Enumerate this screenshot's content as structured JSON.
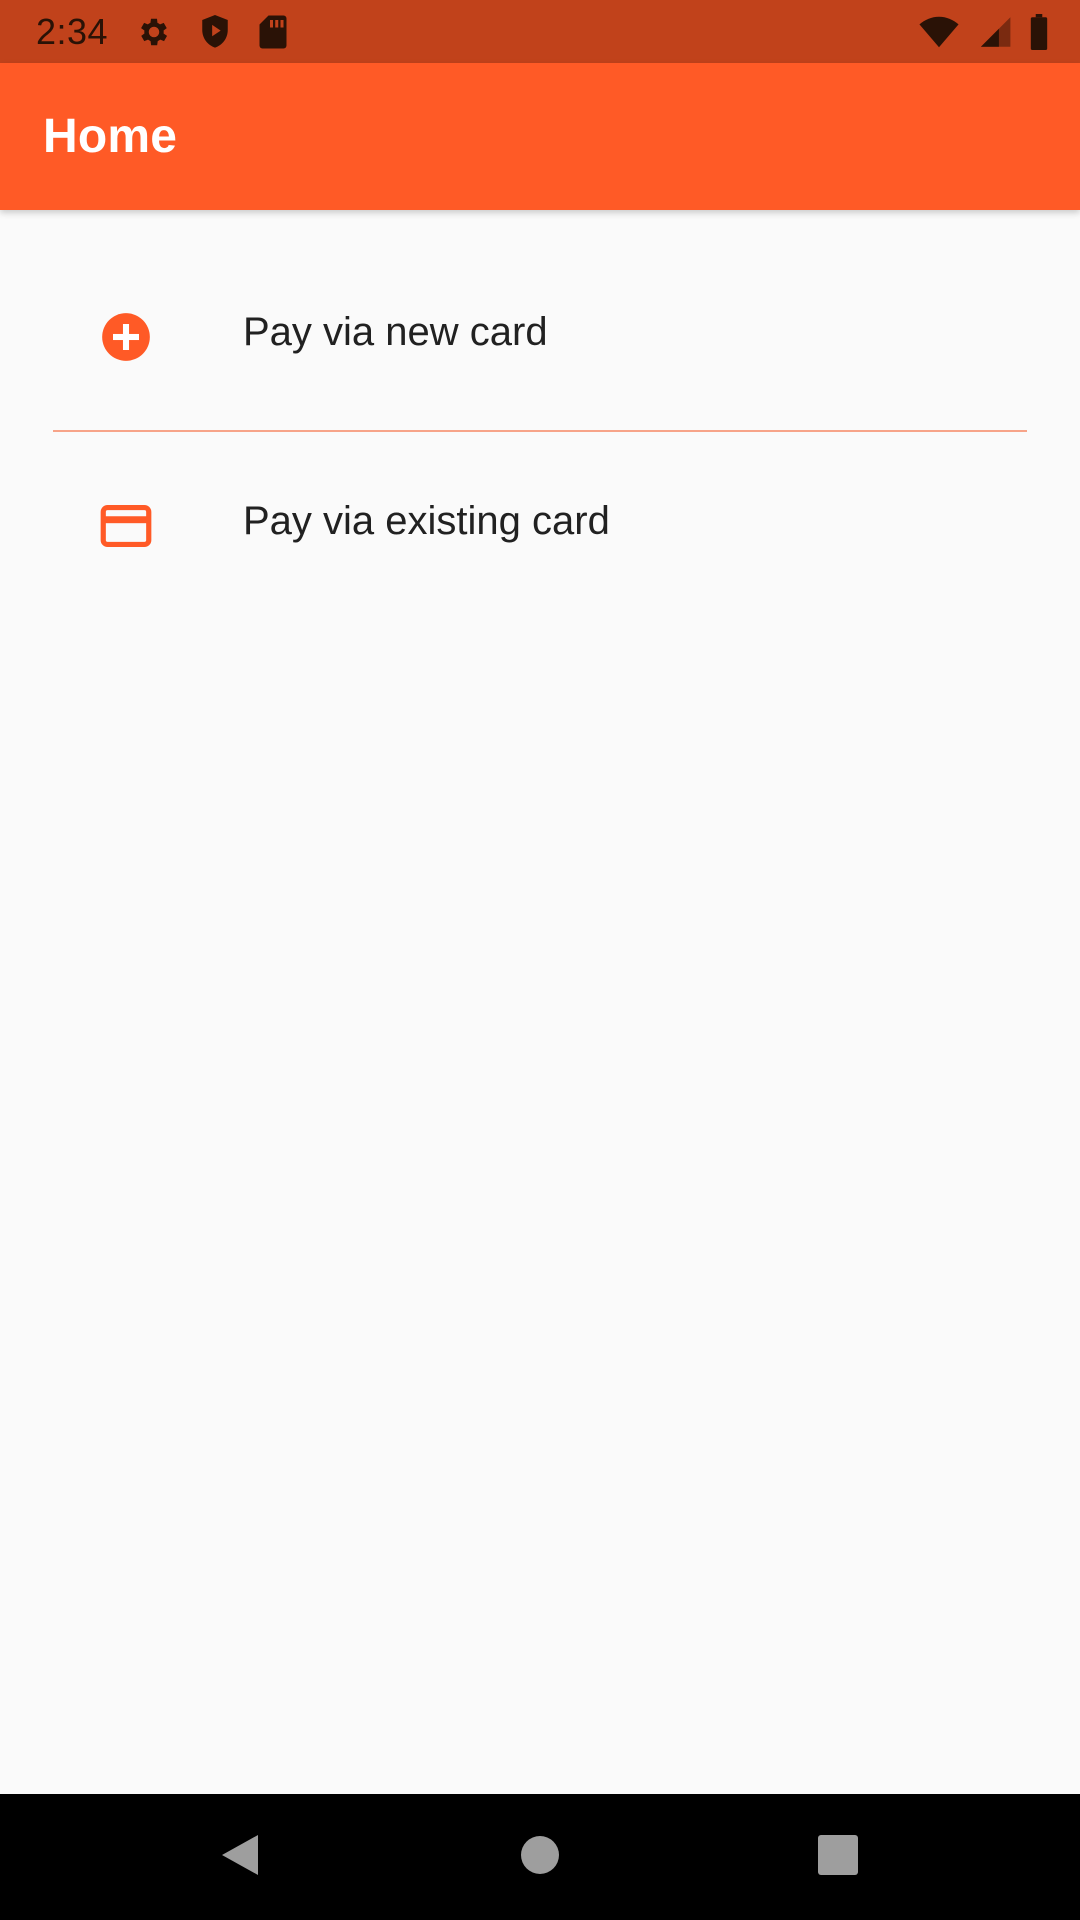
{
  "status_bar": {
    "time": "2:34",
    "left_icons": [
      "gear-icon",
      "shield-play-icon",
      "sd-card-icon"
    ],
    "right_icons": [
      "wifi-icon",
      "signal-icon",
      "battery-icon"
    ]
  },
  "app_bar": {
    "title": "Home",
    "color": "#ff5a26"
  },
  "list": {
    "items": [
      {
        "label": "Pay via new card",
        "icon": "add-circle-icon"
      },
      {
        "label": "Pay via existing card",
        "icon": "credit-card-icon"
      }
    ],
    "divider_color": "#f7a489"
  },
  "nav_bar": {
    "buttons": [
      "back-icon",
      "home-icon",
      "recents-icon"
    ]
  }
}
